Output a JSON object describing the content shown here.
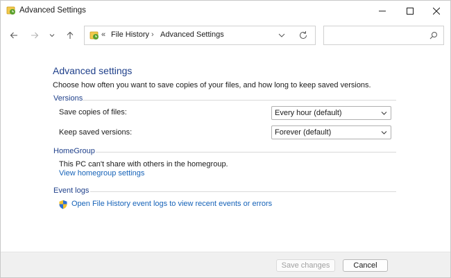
{
  "window": {
    "title": "Advanced Settings",
    "icon": "file-history-icon"
  },
  "caption_buttons": {
    "minimize": "minimize-icon",
    "maximize": "maximize-icon",
    "close": "close-icon"
  },
  "nav": {
    "back": "back-arrow-icon",
    "forward": "forward-arrow-icon",
    "recent": "chevron-down-icon",
    "up": "up-arrow-icon"
  },
  "address": {
    "overflow": "«",
    "crumbs": [
      "File History",
      "Advanced Settings"
    ],
    "separator": "›"
  },
  "search": {
    "placeholder": "",
    "value": ""
  },
  "main": {
    "heading": "Advanced settings",
    "description": "Choose how often you want to save copies of your files, and how long to keep saved versions.",
    "versions": {
      "label": "Versions",
      "save_copies_label": "Save copies of files:",
      "save_copies_value": "Every hour (default)",
      "keep_versions_label": "Keep saved versions:",
      "keep_versions_value": "Forever (default)"
    },
    "homegroup": {
      "label": "HomeGroup",
      "text": "This PC can't share with others in the homegroup.",
      "link": "View homegroup settings"
    },
    "event_logs": {
      "label": "Event logs",
      "link": "Open File History event logs to view recent events or errors"
    }
  },
  "footer": {
    "save_label": "Save changes",
    "cancel_label": "Cancel"
  },
  "colors": {
    "accent_heading": "#1e3f8a",
    "link": "#1562b8",
    "footer_bg": "#f0f0f0"
  }
}
